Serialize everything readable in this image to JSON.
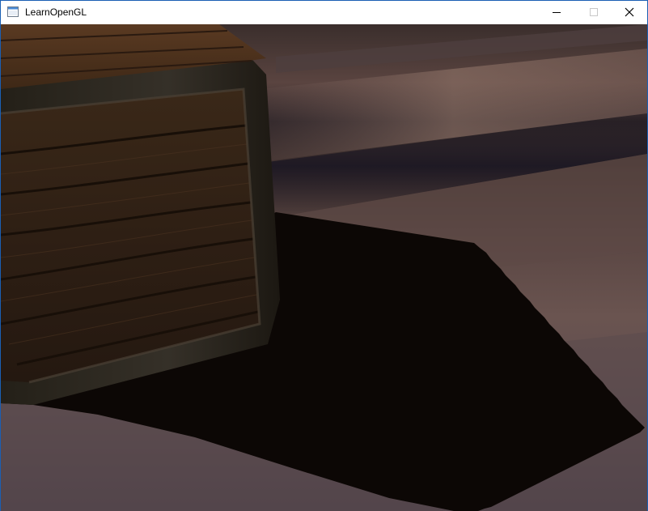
{
  "window": {
    "title": "LearnOpenGL",
    "app_icon": "window-app-icon",
    "controls": {
      "minimize_icon": "minimize-icon",
      "maximize_icon": "maximize-icon",
      "close_icon": "close-icon"
    }
  },
  "scene": {
    "description_icon": "opengl-render-viewport"
  },
  "colors": {
    "titlebar_bg": "#ffffff",
    "window_border": "#1a5fb4",
    "control_disabled": "#c8c8c8"
  }
}
